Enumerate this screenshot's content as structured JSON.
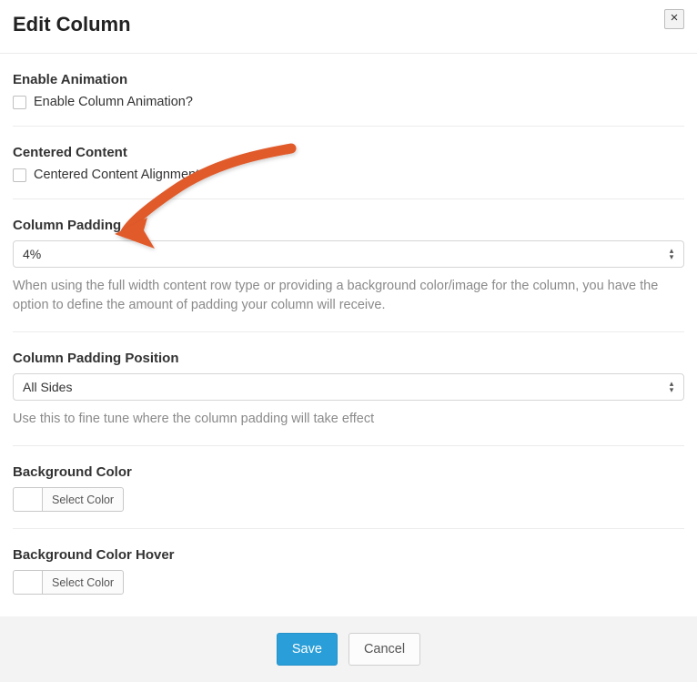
{
  "header": {
    "title": "Edit Column",
    "close_symbol": "×"
  },
  "sections": {
    "enable_animation": {
      "title": "Enable Animation",
      "checkbox_label": "Enable Column Animation?"
    },
    "centered_content": {
      "title": "Centered Content",
      "checkbox_label": "Centered Content Alignment"
    },
    "column_padding": {
      "title": "Column Padding",
      "value": "4%",
      "helper": "When using the full width content row type or providing a background color/image for the column, you have the option to define the amount of padding your column will receive."
    },
    "column_padding_position": {
      "title": "Column Padding Position",
      "value": "All Sides",
      "helper": "Use this to fine tune where the column padding will take effect"
    },
    "background_color": {
      "title": "Background Color",
      "button_label": "Select Color"
    },
    "background_color_hover": {
      "title": "Background Color Hover",
      "button_label": "Select Color"
    }
  },
  "footer": {
    "save_label": "Save",
    "cancel_label": "Cancel"
  },
  "colors": {
    "primary": "#2a9ed8",
    "annotation": "#e05a2b"
  }
}
